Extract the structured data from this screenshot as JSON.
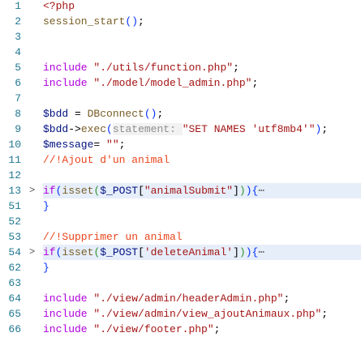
{
  "colors": {
    "keyword": "#af00db",
    "string": "#a31515",
    "function": "#795e26",
    "variable": "#001080",
    "comment": "#e8451c",
    "line_number": "#237893",
    "fold_highlight": "#e6eefa"
  },
  "lines": [
    {
      "n": "1",
      "tokens": [
        [
          "str",
          "<?php"
        ]
      ]
    },
    {
      "n": "2",
      "tokens": [
        [
          "fn",
          "session_start"
        ],
        [
          "paren",
          "()"
        ],
        [
          "p",
          ";"
        ]
      ]
    },
    {
      "n": "3",
      "tokens": []
    },
    {
      "n": "4",
      "tokens": []
    },
    {
      "n": "5",
      "tokens": [
        [
          "kw",
          "include"
        ],
        [
          "p",
          " "
        ],
        [
          "str",
          "\"./utils/function.php\""
        ],
        [
          "p",
          ";"
        ]
      ]
    },
    {
      "n": "6",
      "tokens": [
        [
          "kw",
          "include"
        ],
        [
          "p",
          " "
        ],
        [
          "str",
          "\"./model/model_admin.php\""
        ],
        [
          "p",
          ";"
        ]
      ]
    },
    {
      "n": "7",
      "tokens": []
    },
    {
      "n": "8",
      "tokens": [
        [
          "var",
          "$bdd"
        ],
        [
          "p",
          " = "
        ],
        [
          "fn",
          "DBconnect"
        ],
        [
          "paren",
          "()"
        ],
        [
          "p",
          ";"
        ]
      ]
    },
    {
      "n": "9",
      "tokens": [
        [
          "var",
          "$bdd"
        ],
        [
          "p",
          "->"
        ],
        [
          "fn",
          "exec"
        ],
        [
          "paren",
          "("
        ],
        [
          "hint",
          "statement: "
        ],
        [
          "str",
          "\"SET NAMES 'utf8mb4'\""
        ],
        [
          "paren",
          ")"
        ],
        [
          "p",
          ";"
        ]
      ]
    },
    {
      "n": "10",
      "tokens": [
        [
          "var",
          "$message"
        ],
        [
          "p",
          "= "
        ],
        [
          "str",
          "\"\""
        ],
        [
          "p",
          ";"
        ]
      ]
    },
    {
      "n": "11",
      "tokens": [
        [
          "com",
          "//!Ajout d'un animal"
        ]
      ]
    },
    {
      "n": "12",
      "tokens": []
    },
    {
      "n": "13",
      "fold": true,
      "tokens": [
        [
          "kw",
          "if"
        ],
        [
          "paren",
          "("
        ],
        [
          "fn",
          "isset"
        ],
        [
          "paren2",
          "("
        ],
        [
          "var",
          "$_POST"
        ],
        [
          "p",
          "["
        ],
        [
          "str",
          "\"animalSubmit\""
        ],
        [
          "p",
          "]"
        ],
        [
          "paren2",
          ")"
        ],
        [
          "paren",
          ")"
        ],
        [
          "paren",
          "{"
        ],
        [
          "ell",
          "⋯"
        ]
      ]
    },
    {
      "n": "51",
      "tokens": [
        [
          "paren",
          "}"
        ]
      ]
    },
    {
      "n": "52",
      "tokens": []
    },
    {
      "n": "53",
      "tokens": [
        [
          "com",
          "//!Supprimer un animal"
        ]
      ]
    },
    {
      "n": "54",
      "fold": true,
      "tokens": [
        [
          "kw",
          "if"
        ],
        [
          "paren",
          "("
        ],
        [
          "fn",
          "isset"
        ],
        [
          "paren2",
          "("
        ],
        [
          "var",
          "$_POST"
        ],
        [
          "p",
          "["
        ],
        [
          "str",
          "'deleteAnimal'"
        ],
        [
          "p",
          "]"
        ],
        [
          "paren2",
          ")"
        ],
        [
          "paren",
          ")"
        ],
        [
          "paren",
          "{"
        ],
        [
          "ell",
          "⋯"
        ]
      ]
    },
    {
      "n": "62",
      "tokens": [
        [
          "paren",
          "}"
        ]
      ]
    },
    {
      "n": "63",
      "tokens": []
    },
    {
      "n": "64",
      "tokens": [
        [
          "kw",
          "include"
        ],
        [
          "p",
          " "
        ],
        [
          "str",
          "\"./view/admin/headerAdmin.php\""
        ],
        [
          "p",
          ";"
        ]
      ]
    },
    {
      "n": "65",
      "tokens": [
        [
          "kw",
          "include"
        ],
        [
          "p",
          " "
        ],
        [
          "str",
          "\"./view/admin/view_ajoutAnimaux.php\""
        ],
        [
          "p",
          ";"
        ]
      ]
    },
    {
      "n": "66",
      "tokens": [
        [
          "kw",
          "include"
        ],
        [
          "p",
          " "
        ],
        [
          "str",
          "\"./view/footer.php\""
        ],
        [
          "p",
          ";"
        ]
      ]
    }
  ]
}
